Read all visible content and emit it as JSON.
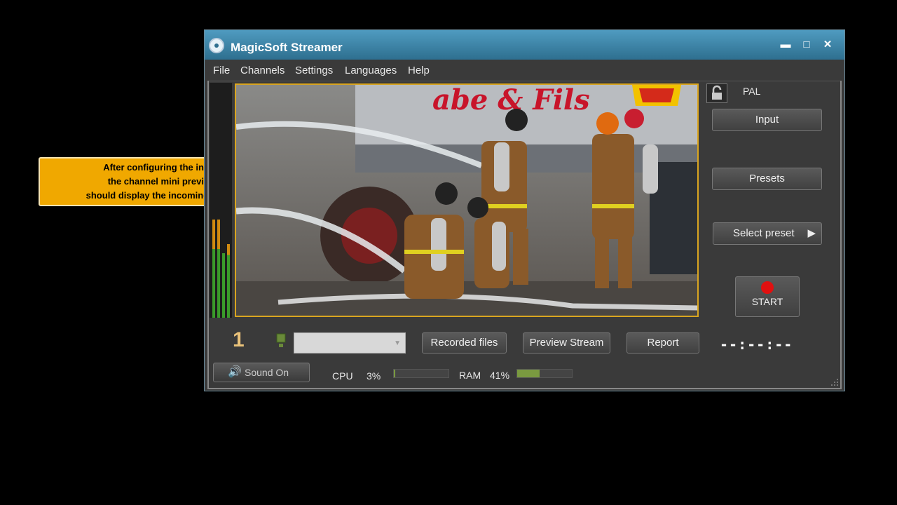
{
  "callout": {
    "line1": "After configuring the input,",
    "line2": "the channel mini preview",
    "line3": "should display the incoming video."
  },
  "window": {
    "title": "MagicSoft Streamer",
    "controls": {
      "minimize": "▬",
      "maximize": "□",
      "close": "✕"
    }
  },
  "menu": [
    "File",
    "Channels",
    "Settings",
    "Languages",
    "Help"
  ],
  "preview": {
    "video_banner_text": "abe & Fils"
  },
  "sidebar": {
    "standard": "PAL",
    "input_label": "Input",
    "presets_label": "Presets",
    "select_preset_label": "Select preset",
    "start_label": "START"
  },
  "channel": {
    "number": "1",
    "dropdown_value": ""
  },
  "actions": {
    "recorded_files": "Recorded files",
    "preview_stream": "Preview Stream",
    "report": "Report"
  },
  "timecode": "--:--:--",
  "status": {
    "sound_label": "Sound On",
    "cpu_label": "CPU",
    "cpu_value": "3%",
    "cpu_fraction": 0.03,
    "ram_label": "RAM",
    "ram_value": "41%",
    "ram_fraction": 0.41
  },
  "colors": {
    "accent_orange": "#f0a800",
    "record_red": "#e01010",
    "preview_border": "#d9a520",
    "meter_green": "#3a9a2a",
    "meter_orange": "#d08a10"
  }
}
